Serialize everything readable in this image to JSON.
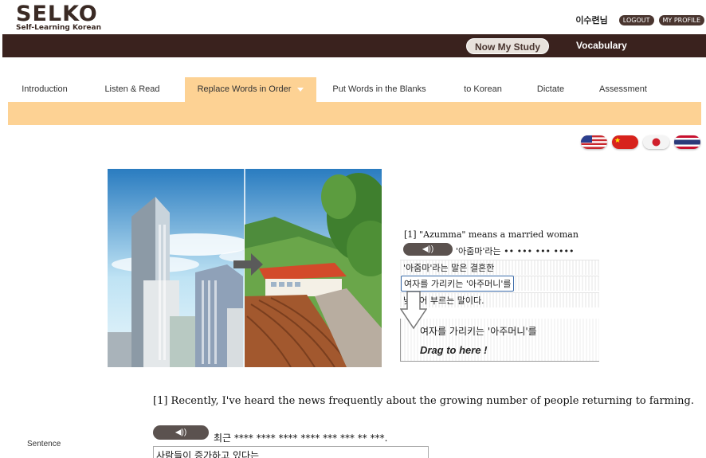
{
  "header": {
    "logo_text": "SELKO",
    "logo_sub": "Self-Learning Korean",
    "user_name": "이수련님",
    "logout_label": "LOGOUT",
    "profile_label": "MY PROFILE"
  },
  "topbar": {
    "now_study_label": "Now My Study",
    "vocabulary_label": "Vocabulary"
  },
  "tabs": [
    {
      "label": "Introduction",
      "active": false
    },
    {
      "label": "Listen & Read",
      "active": false
    },
    {
      "label": "Replace Words in Order",
      "active": true
    },
    {
      "label": "Put Words in the Blanks",
      "active": false
    },
    {
      "label": "to Korean",
      "active": false
    },
    {
      "label": "Dictate",
      "active": false
    },
    {
      "label": "Assessment",
      "active": false
    }
  ],
  "flags": [
    "us-flag",
    "china-flag",
    "japan-flag",
    "thailand-flag"
  ],
  "panel": {
    "title": "[1] \"Azumma\" means a married woman",
    "masked_line": "'아줌마'라는 •• ••• ••• ••••",
    "word_1": "'아줌마'라는 말은 결혼한",
    "word_2": "여자를 가리키는 '아주머니'를",
    "word_3": "낮추어 부르는 말이다.",
    "dropped_word": "여자를 가리키는 '아주머니'를",
    "drop_hint": "Drag to here !"
  },
  "sentence": {
    "english": "[1] Recently, I've heard the news frequently about the growing number of people returning to farming.",
    "korean_masked": "최근 **** **** **** **** *** *** ** ***.",
    "answer_fragment": "사람들이 증가하고 있다는",
    "label": "Sentence"
  },
  "colors": {
    "brown_bar": "#3a221e",
    "tab_accent": "#fdd294",
    "highlight_border": "#3a6aa8"
  }
}
